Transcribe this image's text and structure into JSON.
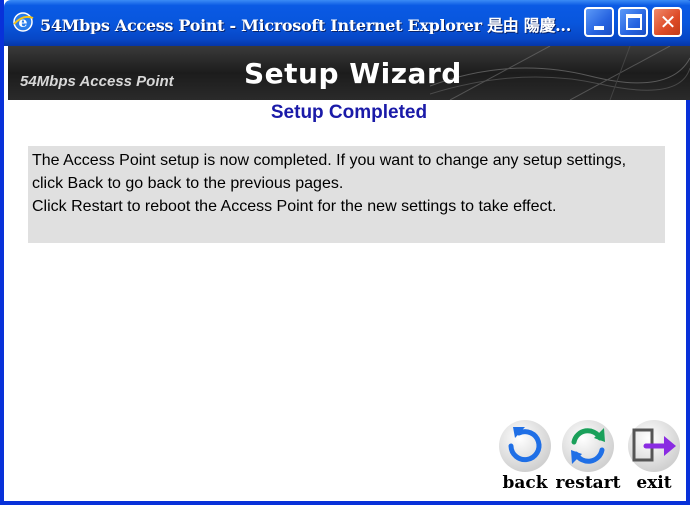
{
  "window": {
    "title": "54Mbps Access Point - Microsoft Internet Explorer 是由 陽慶...",
    "controls": {
      "minimize": "minimize",
      "maximize": "maximize",
      "close": "✕"
    }
  },
  "banner": {
    "product": "54Mbps Access Point",
    "title": "Setup Wizard"
  },
  "page": {
    "heading": "Setup Completed",
    "message_line1": "The Access Point setup is now completed. If you want to change any setup settings, click Back to go back to the previous pages.",
    "message_line2": "Click Restart to reboot the Access Point for the new settings to take effect."
  },
  "actions": {
    "back": "back",
    "restart": "restart",
    "exit": "exit"
  },
  "colors": {
    "titlebar": "#0a5ae4",
    "heading": "#1a1aa8",
    "message_bg": "#e0e0e0",
    "back_icon": "#1f6fe6",
    "restart_icon": "#1aa05a",
    "exit_icon": "#8a2be2"
  }
}
